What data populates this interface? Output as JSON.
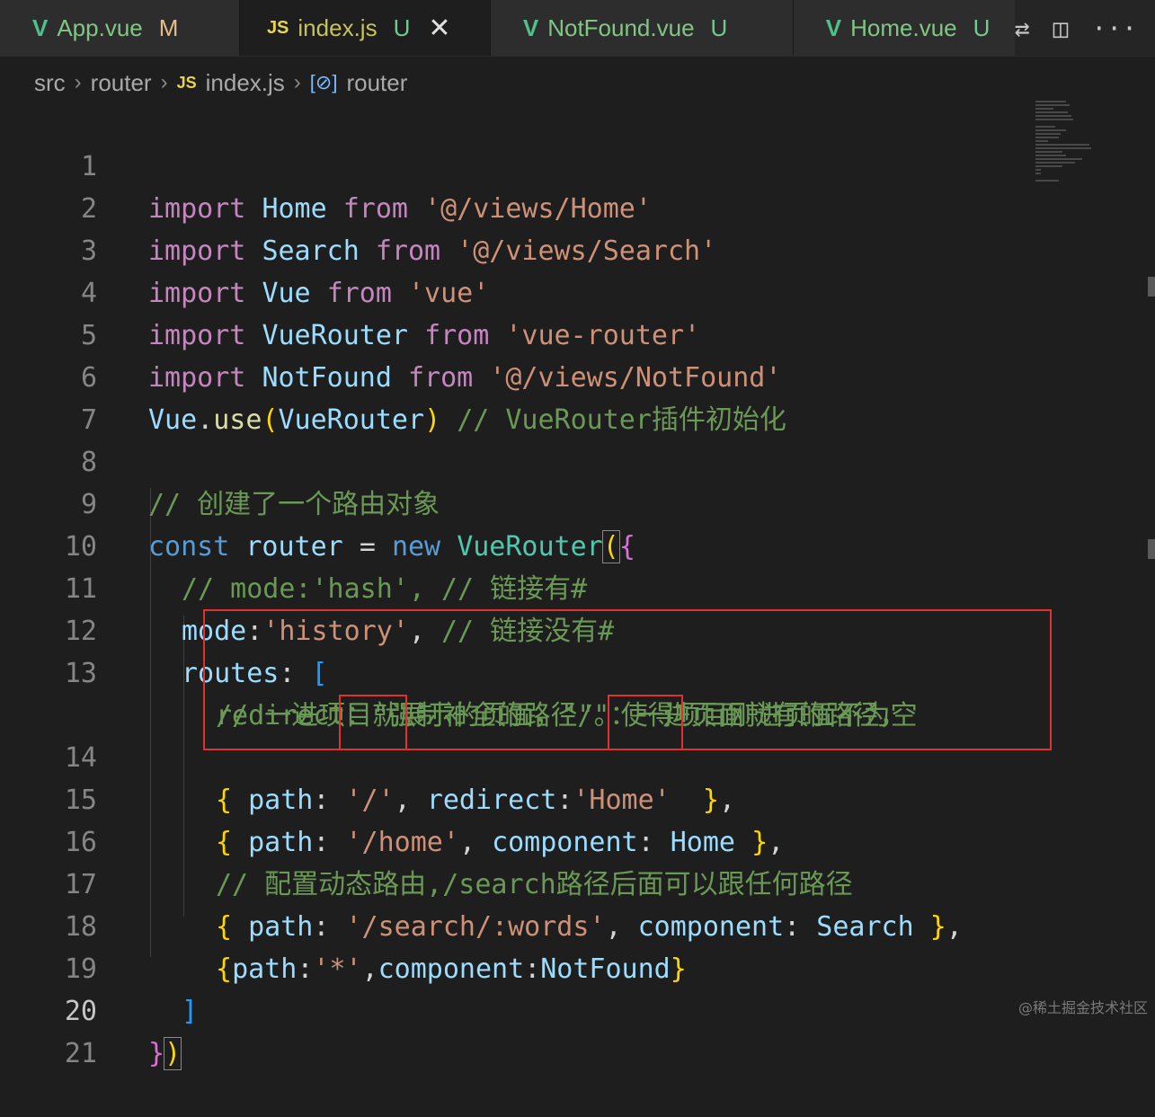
{
  "tabs": [
    {
      "icon": "V",
      "name": "App.vue",
      "status": "M"
    },
    {
      "icon": "JS",
      "name": "index.js",
      "status": "U",
      "close": "✕"
    },
    {
      "icon": "V",
      "name": "NotFound.vue",
      "status": "U"
    },
    {
      "icon": "V",
      "name": "Home.vue",
      "status": "U"
    }
  ],
  "tab_actions": {
    "compare": "⇄",
    "split": "◫",
    "more": "···"
  },
  "breadcrumb": {
    "src": "src",
    "router": "router",
    "js": "JS",
    "file": "index.js",
    "symbol_icon": "[⊘]",
    "symbol": "router"
  },
  "lines": {
    "n1": "1",
    "n2": "2",
    "n3": "3",
    "n4": "4",
    "n5": "5",
    "n6": "6",
    "n7": "7",
    "n8": "8",
    "n9": "9",
    "n10": "10",
    "n11": "11",
    "n12": "12",
    "n13": "13",
    "n14": "14",
    "n15": "15",
    "n16": "16",
    "n17": "17",
    "n18": "18",
    "n19": "19",
    "n20": "20",
    "n21": "21"
  },
  "code": {
    "import": "import",
    "from": "from",
    "home": "Home",
    "home_path": "'@/views/Home'",
    "search": "Search",
    "search_path": "'@/views/Search'",
    "vue": "Vue",
    "vue_path": "'vue'",
    "vuerouter": "VueRouter",
    "vuerouter_path": "'vue-router'",
    "notfound": "NotFound",
    "notfound_path": "'@/views/NotFound'",
    "use": "use",
    "l6_comment": "// VueRouter插件初始化",
    "l8_comment": "// 创建了一个路由对象",
    "const": "const",
    "router": "router",
    "eq": "=",
    "new": "new",
    "l10_comment": "// mode:'hash', // 链接有#",
    "mode_key": "mode",
    "mode_val": "'history'",
    "l11_comment": "// 链接没有#",
    "routes_key": "routes",
    "l13_comment_a": "// 一进项目就展示的页面，\"/\"：一进页面就有的路径，",
    "l13_comment_b": "redirect：\"强制补全的路径\"。使得项目刚进页面不为空",
    "path_key": "path",
    "redirect_key": "redirect",
    "component_key": "component",
    "root_path": "'/'",
    "redirect_val": "'Home'",
    "home_route": "'/home'",
    "l16_comment": "// 配置动态路由,/search路径后面可以跟任何路径",
    "search_route": "'/search/:words'",
    "star": "'*'"
  },
  "watermark": "@稀土掘金技术社区"
}
